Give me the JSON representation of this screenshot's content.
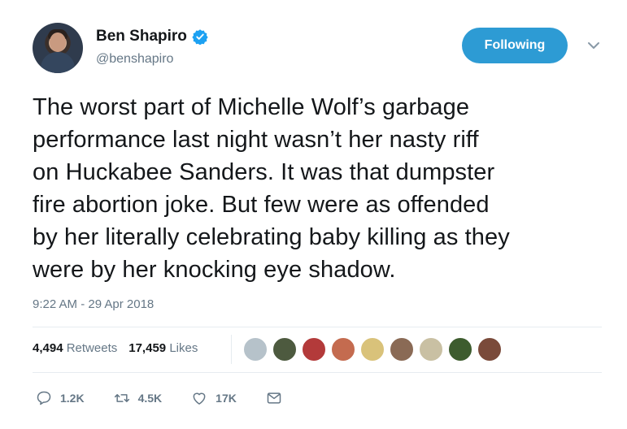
{
  "author": {
    "display_name": "Ben Shapiro",
    "handle": "@benshapiro",
    "verified": true
  },
  "follow_button": {
    "label": "Following",
    "color": "#2d9bd4"
  },
  "tweet": {
    "lines": [
      "The worst part of Michelle Wolf’s garbage",
      "performance last night wasn’t her nasty riff",
      "on Huckabee Sanders. It was that dumpster",
      "fire abortion joke. But few were as offended",
      "by her literally celebrating baby killing as they",
      "were by her knocking eye shadow."
    ],
    "timestamp": "9:22 AM - 29 Apr 2018"
  },
  "stats": {
    "retweets_count": "4,494",
    "retweets_label": "Retweets",
    "likes_count": "17,459",
    "likes_label": "Likes"
  },
  "likers": [
    {
      "color": "#b6c2ca"
    },
    {
      "color": "#4d5a3f"
    },
    {
      "color": "#b33a3a"
    },
    {
      "color": "#c46b4f"
    },
    {
      "color": "#d9c27a"
    },
    {
      "color": "#8a6a55"
    },
    {
      "color": "#c9c0a3"
    },
    {
      "color": "#3d5c2e"
    },
    {
      "color": "#7a4a3a"
    }
  ],
  "actions": {
    "reply_count": "1.2K",
    "retweet_count": "4.5K",
    "like_count": "17K"
  },
  "colors": {
    "accent": "#1da1f2",
    "muted": "#657786",
    "text": "#14171a"
  }
}
